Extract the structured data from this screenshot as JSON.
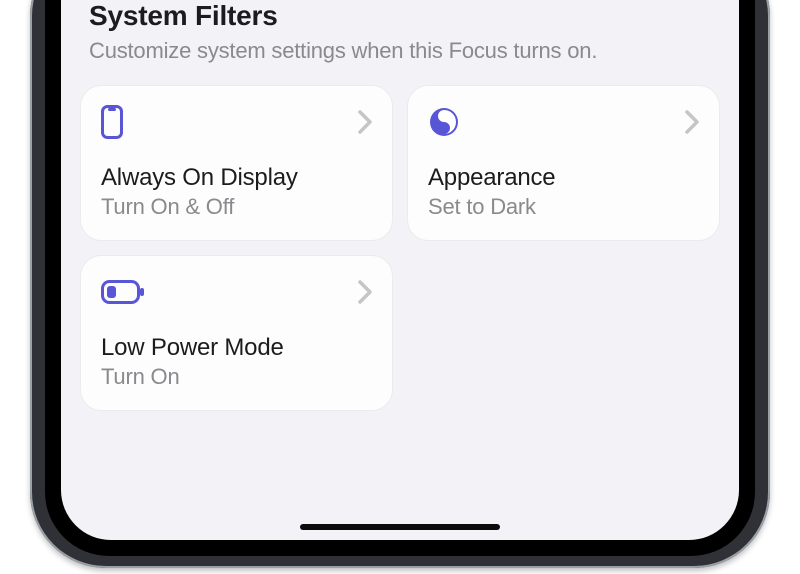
{
  "colors": {
    "accent": "#5856d6",
    "text_secondary": "#8a8a8e",
    "background": "#f2f2f7",
    "card_background": "#fdfdfd"
  },
  "section": {
    "title": "System Filters",
    "subtitle": "Customize system settings when this Focus turns on."
  },
  "filters": [
    {
      "icon": "phone-icon",
      "title": "Always On Display",
      "subtitle": "Turn On & Off"
    },
    {
      "icon": "contrast-icon",
      "title": "Appearance",
      "subtitle": "Set to Dark"
    },
    {
      "icon": "battery-icon",
      "title": "Low Power Mode",
      "subtitle": "Turn On"
    }
  ]
}
